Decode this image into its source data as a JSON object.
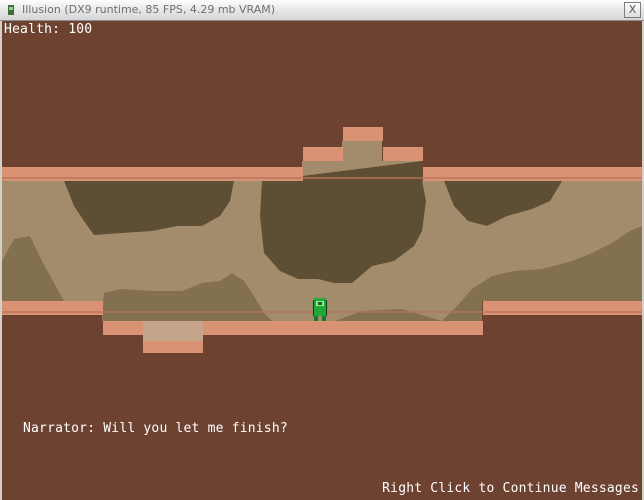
{
  "window": {
    "title": "Illusion (DX9 runtime, 85 FPS, 4.29 mb VRAM)",
    "close_label": "X"
  },
  "hud": {
    "health_text": "Health: 100",
    "narrator_text": "Narrator: Will you let me finish?",
    "continue_hint": "Right Click to Continue Messages"
  },
  "colors": {
    "dirt": "#6d4230",
    "ground_top": "#d99274",
    "cave_light": "#a38c6b",
    "cave_mid": "#83704f",
    "cave_dark": "#5e4f34",
    "player": "#22a838"
  },
  "icons": {
    "app": "illusion-app-icon",
    "close": "close-icon"
  }
}
